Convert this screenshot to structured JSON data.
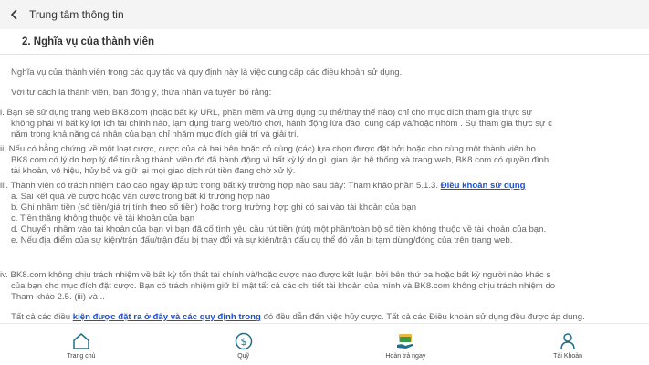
{
  "header": {
    "title": "Trung tâm thông tin"
  },
  "section": {
    "title": "2.  Nghĩa vụ của thành viên"
  },
  "content": {
    "intro": "Nghĩa vụ của thành viên trong các quy tắc và quy định này là việc cung cấp các điều khoản sử dụng.",
    "agree": "Với tư cách là thành viên, bạn đồng ý, thừa nhận và tuyên bố rằng:",
    "item_i": [
      "i. Bạn sẽ sử dụng trang web BK8.com (hoặc bất kỳ URL, phần mềm và ứng dụng cụ thể/thay thế nào) chỉ cho mục đích tham gia thực sự",
      "không phải vì bất kỳ lợi ích tài chính nào, lạm dụng trang web/trò chơi, hành động lừa đảo, cung cấp và/hoặc nhóm . Sự tham gia thực sự c",
      "nằm trong khả năng cá nhân của bạn chỉ nhằm mục đích giải trí và giải trí."
    ],
    "item_ii": [
      "ii. Nếu có bằng chứng về một loạt cược, cược của cả hai bên hoặc cỏ cùng (các) lựa chọn được đặt bởi hoặc cho cùng một thành viên ho",
      "BK8.com có lý do hợp lý để tin rằng thành viên đó đã hành động vì bất kỳ lý do gì. gian lận hệ thống và trang web, BK8.com có quyền đình",
      "tài khoản, vô hiệu, hủy bỏ và giữ lại mọi giao dịch rút tiền đang chờ xử lý."
    ],
    "item_iii_text": "iii. Thành viên có trách nhiệm báo cáo ngay lập tức trong bất kỳ trường hợp nào sau đây: Tham khảo phần 5.1.3.",
    "item_iii_link": "Điều khoản sử dụng",
    "sub_items": [
      "a. Sai kết quả về cược hoặc vấn cược trong bất kì trường hợp nào",
      "b. Ghi nhầm tiền (số tiền/giá trị tính theo số tiền) hoặc trong trường hợp ghi có sai vào tài khoản của bạn",
      "c. Tiền thắng không thuộc về tài khoản của bạn",
      "d. Chuyển nhầm vào tài khoản của bạn vì bạn đã cố tình yêu cầu rút tiền (rút) một phần/toàn bộ số tiền không thuộc về tài khoản của bạn.",
      "e. Nếu địa điểm của sự kiện/trận đấu/trận đấu bị thay đổi và sự kiện/trận đấu cụ thể đó vẫn bị tạm dừng/đóng của trên trang web."
    ],
    "item_iv": [
      "iv. BK8.com không chịu trách nhiệm về bất kỳ tổn thất tài chính và/hoặc cược nào được kết luận bởi bên thứ ba hoặc bất kỳ người nào khác s",
      "của bạn cho mục đích đặt cược. Bạn có trách nhiệm giữ bí mật tất cả các chi tiết tài khoản của mình và BK8.com không chịu trách nhiệm do",
      "Tham khảo 2.5. (iii) và .."
    ],
    "final_pre": "Tất cả các điều",
    "final_link": "kiện được đặt ra ở đây và các quy định trong",
    "final_post": "đó đều dẫn đến việc hủy cược. Tất cả các Điều khoản sử dụng đều được áp dụng."
  },
  "nav": {
    "home": "Trang chủ",
    "fund": "Quỹ",
    "rebate": "Hoàn trả ngay",
    "account": "Tài Khoản"
  },
  "colors": {
    "link": "#1a4fd8",
    "icon": "#1f6f8b",
    "topbar": "#f4f4f4"
  }
}
